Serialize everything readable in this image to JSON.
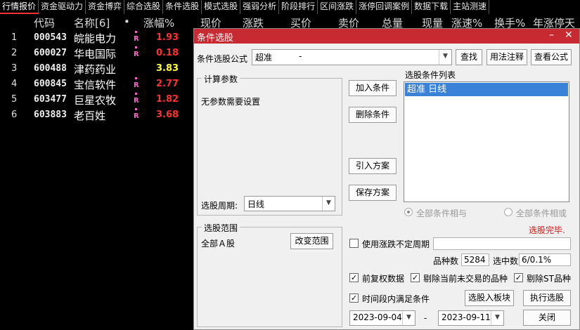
{
  "top_tabs": [
    "行情报价",
    "资金驱动力",
    "资金博弈",
    "综合选股",
    "条件选股",
    "模式选股",
    "强弱分析",
    "阶段排行",
    "区间涨跌",
    "涨停回调案例",
    "数据下载",
    "主站测速"
  ],
  "table": {
    "headers": {
      "code": "代码",
      "name": "名称[6]",
      "dot": "•",
      "pct": "涨幅%",
      "price": "现价",
      "change": "涨跌",
      "buy": "买价",
      "sell": "卖价",
      "volume": "总量",
      "cur": "现量",
      "speed": "涨速%",
      "turnover": "换手%",
      "stop": "年涨停天"
    },
    "rows": [
      {
        "idx": "1",
        "code": "000543",
        "name": "皖能电力",
        "flag": "R",
        "pct": "1.93"
      },
      {
        "idx": "2",
        "code": "600027",
        "name": "华电国际",
        "flag": "R",
        "pct": "0.18"
      },
      {
        "idx": "3",
        "code": "600488",
        "name": "津药药业",
        "flag": "",
        "pct": "3.83"
      },
      {
        "idx": "4",
        "code": "600845",
        "name": "宝信软件",
        "flag": "R",
        "pct": "2.77"
      },
      {
        "idx": "5",
        "code": "603477",
        "name": "巨星农牧",
        "flag": "R",
        "pct": "1.82"
      },
      {
        "idx": "6",
        "code": "603883",
        "name": "老百姓",
        "flag": "R",
        "pct": "3.68"
      }
    ]
  },
  "dialog": {
    "title": "条件选股",
    "minimize": "–",
    "close": "✕",
    "formula_label": "条件选股公式",
    "formula_value": "超准",
    "formula_dash": "-",
    "find_btn": "查找",
    "usage_btn": "用法注释",
    "view_formula_btn": "查看公式",
    "calc_params_title": "计算参数",
    "no_params": "无参数需要设置",
    "period_label": "选股周期:",
    "period_value": "日线",
    "add_cond": "加入条件",
    "del_cond": "删除条件",
    "import_plan": "引入方案",
    "save_plan": "保存方案",
    "cond_list_label": "选股条件列表",
    "cond_list_item": "超准  日线",
    "and_label": "全部条件相与",
    "or_label": "全部条件相或",
    "done": "选股完毕.",
    "scope_title": "选股范围",
    "scope_value": "全部Ａ股",
    "change_scope": "改变范围",
    "use_period": "使用涨跌不定周期",
    "count_label": "品种数",
    "count_value": "5284",
    "selected_label": "选中数",
    "selected_value": "6/0.1%",
    "prior_adj": "前复权数据",
    "exclude_untraded": "剔除当前未交易的品种",
    "exclude_st": "剔除ST品种",
    "within_period": "时间段内满足条件",
    "to_board": "选股入板块",
    "execute": "执行选股",
    "date_from": "2023-09-04",
    "date_sep": "-",
    "date_to": "2023-09-11",
    "close_btn": "关闭",
    "colors": {
      "title_bg": "#c82a32",
      "select_bg": "#3a82d8",
      "done_text": "#d02020"
    }
  }
}
